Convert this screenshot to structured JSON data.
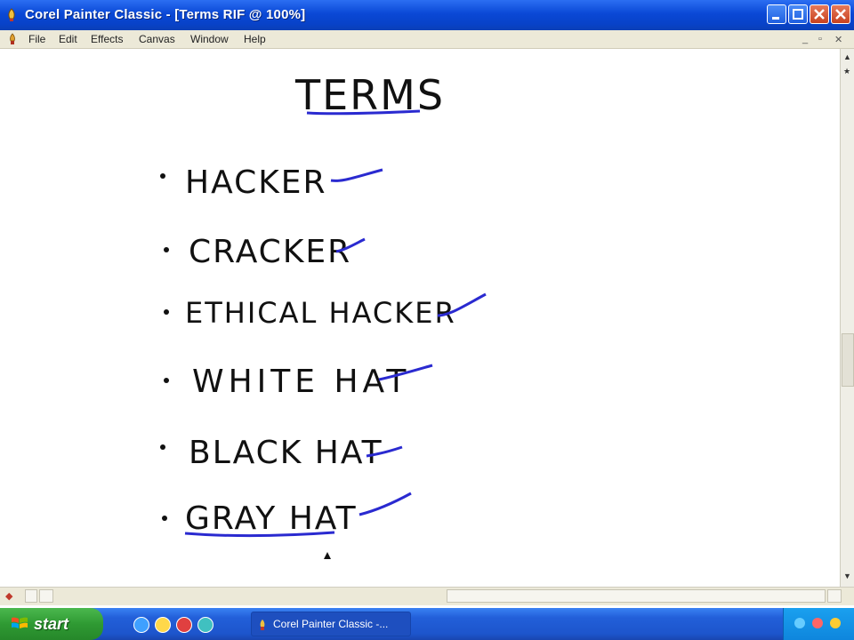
{
  "window": {
    "title": "Corel Painter Classic - [Terms RIF @ 100%]",
    "colors": {
      "titlebar": "#0a48d6",
      "ink": "#111111",
      "accent_ink": "#2a2ad0"
    }
  },
  "menu": {
    "items": [
      "File",
      "Edit",
      "Effects",
      "Canvas",
      "Window",
      "Help"
    ]
  },
  "canvas": {
    "heading": "TERMS",
    "terms": [
      {
        "label": "HACKER",
        "checked": true
      },
      {
        "label": "CRACKER",
        "checked": true
      },
      {
        "label": "ETHICAL HACKER",
        "checked": true
      },
      {
        "label": "WHITE HAT",
        "checked": true
      },
      {
        "label": "BLACK HAT",
        "checked": true
      },
      {
        "label": "GRAY HAT",
        "checked": true
      }
    ]
  },
  "taskbar": {
    "start_label": "start",
    "task_label": "Corel Painter Classic -..."
  },
  "icons": {
    "app": "painter-app-icon",
    "minimize": "minimize-icon",
    "maximize": "maximize-icon",
    "close": "close-icon",
    "start": "windows-flag-icon"
  }
}
